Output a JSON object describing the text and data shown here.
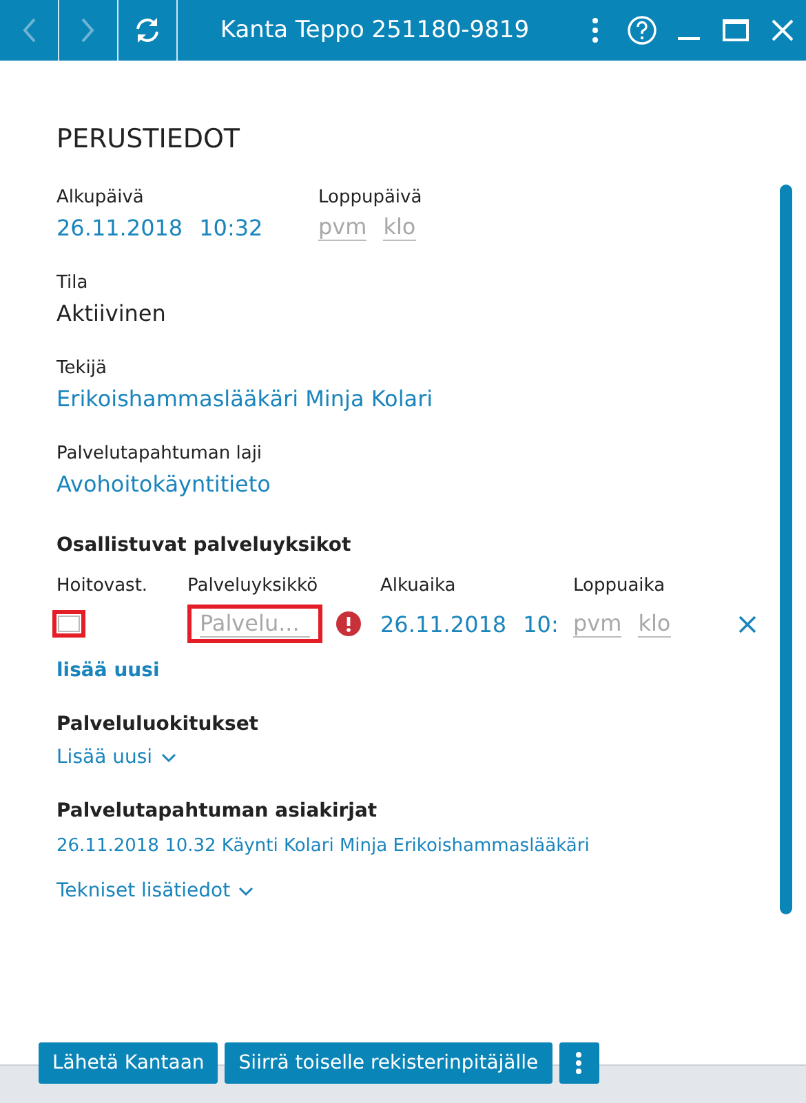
{
  "titlebar": {
    "nav": [
      {
        "kind": "back",
        "disabled": true
      },
      {
        "kind": "forward",
        "disabled": true
      },
      {
        "kind": "refresh",
        "disabled": false
      }
    ],
    "title": "Kanta Teppo 251180-9819"
  },
  "form": {
    "heading": "PERUSTIEDOT",
    "start": {
      "label": "Alkupäivä",
      "date": "26.11.2018",
      "time": "10:32"
    },
    "end": {
      "label": "Loppupäivä",
      "date_placeholder": "pvm",
      "time_placeholder": "klo"
    },
    "fields": [
      {
        "label": "Tila",
        "value": "Aktiivinen",
        "kind": "text"
      },
      {
        "label": "Tekijä",
        "value": "Erikoishammaslääkäri Minja Kolari",
        "kind": "link"
      },
      {
        "label": "Palvelutapahtuman laji",
        "value": "Avohoitokäyntitieto",
        "kind": "link"
      }
    ],
    "units": {
      "heading": "Osallistuvat palveluyksikot",
      "columns": [
        "Hoitovast.",
        "Palveluyksikkö",
        "Alkuaika",
        "Loppuaika"
      ],
      "rows": [
        {
          "checked": false,
          "invalid": true,
          "unit_placeholder": "Palvelu...",
          "unit_invalid": true,
          "start_date": "26.11.2018",
          "start_time": "10:",
          "end_date_placeholder": "pvm",
          "end_time_placeholder": "klo"
        }
      ],
      "add_link": "lisää uusi"
    },
    "classes": {
      "heading": "Palveluluokitukset",
      "add_link": "Lisää uusi"
    },
    "documents": {
      "heading": "Palvelutapahtuman asiakirjat",
      "items": [
        "26.11.2018 10.32 Käynti Kolari Minja Erikoishammaslääkäri"
      ]
    },
    "technical": "Tekniset lisätiedot"
  },
  "footer": {
    "buttons": [
      "Lähetä Kantaan",
      "Siirrä toiselle rekisterinpitäjälle"
    ]
  }
}
